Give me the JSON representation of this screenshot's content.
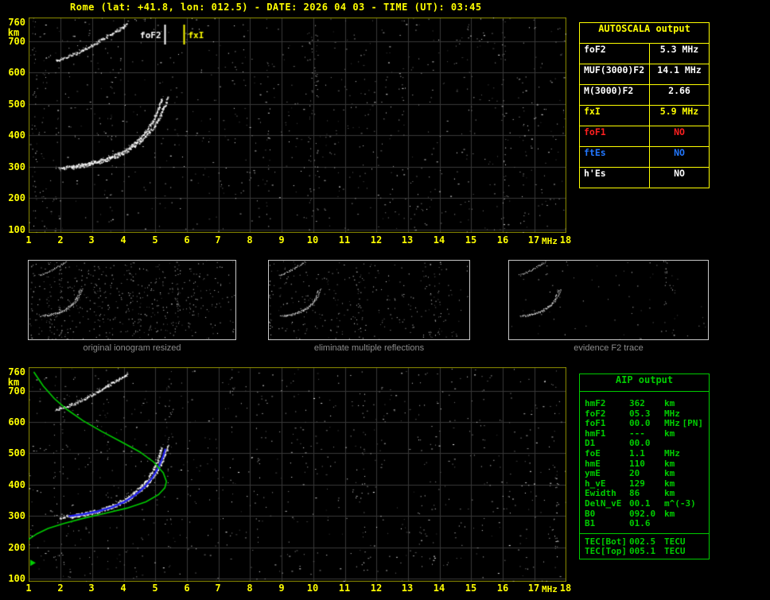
{
  "title": "Rome (lat: +41.8, lon: 012.5) - DATE: 2026 04 03 - TIME (UT): 03:45",
  "colors": {
    "background": "#000000",
    "axis_text": "#ffff00",
    "frame": "#8f8f00",
    "grid": "#383838",
    "echo_white": "#ffffff",
    "profile_green": "#00cc00",
    "restored_blue": "#2222ee",
    "table_yellow": "#ffff00",
    "aip_green": "#00cc00",
    "no_red": "#ff2020",
    "es_blue": "#2277ff",
    "caption_gray": "#8c8c8c"
  },
  "autoscala_table": {
    "title": "AUTOSCALA output",
    "rows": [
      {
        "param": "foF2",
        "value": "5.3 MHz",
        "color": "#ffffff"
      },
      {
        "param": "MUF(3000)F2",
        "value": "14.1 MHz",
        "color": "#ffffff"
      },
      {
        "param": "M(3000)F2",
        "value": "2.66",
        "color": "#ffffff"
      },
      {
        "param": "fxI",
        "value": "5.9 MHz",
        "color": "#ffff00"
      },
      {
        "param": "foF1",
        "value": "NO",
        "color": "#ff2020"
      },
      {
        "param": "ftEs",
        "value": "NO",
        "color": "#2277ff"
      },
      {
        "param": "h'Es",
        "value": "NO",
        "color": "#ffffff"
      }
    ]
  },
  "thumbnails": [
    {
      "caption": "original ionogram resized",
      "noise": 430,
      "columns": 12,
      "seed": 21
    },
    {
      "caption": "eliminate multiple reflections",
      "noise": 250,
      "columns": 9,
      "seed": 22
    },
    {
      "caption": "evidence F2 trace",
      "noise": 70,
      "columns": 2,
      "seed": 23
    }
  ],
  "aip_table": {
    "title": "AIP output",
    "rows": [
      {
        "param": "hmF2",
        "value": "362",
        "unit": "km",
        "note": ""
      },
      {
        "param": "foF2",
        "value": "05.3",
        "unit": "MHz",
        "note": ""
      },
      {
        "param": "foF1",
        "value": "00.0",
        "unit": "MHz",
        "note": "[PN]"
      },
      {
        "param": "hmF1",
        "value": "---",
        "unit": "km",
        "note": ""
      },
      {
        "param": "D1",
        "value": "00.0",
        "unit": "",
        "note": ""
      },
      {
        "param": "foE",
        "value": "1.1",
        "unit": "MHz",
        "note": ""
      },
      {
        "param": "hmE",
        "value": "110",
        "unit": "km",
        "note": ""
      },
      {
        "param": "ymE",
        "value": "20",
        "unit": "km",
        "note": ""
      },
      {
        "param": "h_vE",
        "value": "129",
        "unit": "km",
        "note": ""
      },
      {
        "param": "Ewidth",
        "value": "86",
        "unit": "km",
        "note": ""
      },
      {
        "param": "DelN_vE",
        "value": "00.1",
        "unit": "m^(-3)",
        "note": ""
      },
      {
        "param": "B0",
        "value": "092.0",
        "unit": "km",
        "note": ""
      },
      {
        "param": "B1",
        "value": "01.6",
        "unit": "",
        "note": ""
      }
    ],
    "tec_rows": [
      {
        "param": "TEC[Bot]",
        "value": "002.5",
        "unit": "TECU"
      },
      {
        "param": "TEC[Top]",
        "value": "005.1",
        "unit": "TECU"
      }
    ]
  },
  "chart_data": [
    {
      "name": "top_ionogram",
      "type": "scatter",
      "xlabel": "MHz",
      "ylabel": "km",
      "xlim": [
        1,
        18
      ],
      "ylim": [
        100,
        760
      ],
      "xticks": [
        1,
        2,
        3,
        4,
        5,
        6,
        7,
        8,
        9,
        10,
        11,
        12,
        13,
        14,
        15,
        16,
        17,
        18
      ],
      "yticks": [
        760,
        700,
        600,
        500,
        400,
        300,
        200,
        100
      ],
      "grid": true,
      "markers": [
        {
          "label": "foF2",
          "x": 5.3,
          "color": "#ffffff",
          "label_side": "left"
        },
        {
          "label": "fxI",
          "x": 5.9,
          "color": "#ffff00",
          "label_side": "right"
        }
      ],
      "series": [
        {
          "name": "F2 trace ordinary ray",
          "color": "#ffffff",
          "render": "scatter",
          "points": [
            [
              1.95,
              296
            ],
            [
              2.2,
              300
            ],
            [
              2.5,
              305
            ],
            [
              2.8,
              311
            ],
            [
              3.1,
              318
            ],
            [
              3.4,
              327
            ],
            [
              3.7,
              339
            ],
            [
              4.0,
              354
            ],
            [
              4.3,
              374
            ],
            [
              4.55,
              396
            ],
            [
              4.75,
              420
            ],
            [
              4.9,
              446
            ],
            [
              5.05,
              478
            ],
            [
              5.15,
              505
            ],
            [
              5.2,
              522
            ]
          ]
        },
        {
          "name": "F2 trace extraordinary ray",
          "color": "#ffffff",
          "render": "scatter",
          "points": [
            [
              2.35,
              298
            ],
            [
              2.7,
              304
            ],
            [
              3.05,
              312
            ],
            [
              3.4,
              322
            ],
            [
              3.75,
              335
            ],
            [
              4.1,
              352
            ],
            [
              4.4,
              374
            ],
            [
              4.7,
              400
            ],
            [
              4.95,
              430
            ],
            [
              5.15,
              465
            ],
            [
              5.3,
              500
            ],
            [
              5.4,
              528
            ]
          ]
        },
        {
          "name": "second hop reflection",
          "color": "#ffffff",
          "render": "scatter",
          "points": [
            [
              1.85,
              640
            ],
            [
              2.15,
              650
            ],
            [
              2.45,
              662
            ],
            [
              2.75,
              676
            ],
            [
              3.05,
              692
            ],
            [
              3.35,
              710
            ],
            [
              3.65,
              728
            ],
            [
              3.95,
              745
            ],
            [
              4.12,
              757
            ]
          ]
        }
      ],
      "noise": {
        "count": 850,
        "columns": 14,
        "seed": 7
      }
    },
    {
      "name": "bottom_ionogram",
      "type": "scatter",
      "xlabel": "MHz",
      "ylabel": "km",
      "xlim": [
        1,
        18
      ],
      "ylim": [
        100,
        760
      ],
      "xticks": [
        1,
        2,
        3,
        4,
        5,
        6,
        7,
        8,
        9,
        10,
        11,
        12,
        13,
        14,
        15,
        16,
        17,
        18
      ],
      "yticks": [
        760,
        700,
        600,
        500,
        400,
        300,
        200,
        100
      ],
      "grid": true,
      "series": [
        {
          "name": "F2 trace ordinary ray",
          "color": "#ffffff",
          "render": "scatter",
          "points": [
            [
              1.95,
              296
            ],
            [
              2.2,
              300
            ],
            [
              2.5,
              305
            ],
            [
              2.8,
              311
            ],
            [
              3.1,
              318
            ],
            [
              3.4,
              327
            ],
            [
              3.7,
              339
            ],
            [
              4.0,
              354
            ],
            [
              4.3,
              374
            ],
            [
              4.55,
              396
            ],
            [
              4.75,
              420
            ],
            [
              4.9,
              446
            ],
            [
              5.05,
              478
            ],
            [
              5.15,
              505
            ],
            [
              5.2,
              522
            ]
          ]
        },
        {
          "name": "F2 trace extraordinary ray",
          "color": "#ffffff",
          "render": "scatter",
          "points": [
            [
              2.35,
              298
            ],
            [
              2.7,
              304
            ],
            [
              3.05,
              312
            ],
            [
              3.4,
              322
            ],
            [
              3.75,
              335
            ],
            [
              4.1,
              352
            ],
            [
              4.4,
              374
            ],
            [
              4.7,
              400
            ],
            [
              4.95,
              430
            ],
            [
              5.15,
              465
            ],
            [
              5.3,
              500
            ],
            [
              5.4,
              528
            ]
          ]
        },
        {
          "name": "second hop reflection",
          "color": "#ffffff",
          "render": "scatter",
          "points": [
            [
              1.85,
              640
            ],
            [
              2.15,
              650
            ],
            [
              2.45,
              662
            ],
            [
              2.75,
              676
            ],
            [
              3.05,
              692
            ],
            [
              3.35,
              710
            ],
            [
              3.65,
              728
            ],
            [
              3.95,
              745
            ],
            [
              4.12,
              757
            ]
          ]
        },
        {
          "name": "restored F2 trace",
          "color": "#2222ee",
          "render": "line",
          "width": 2.4,
          "points": [
            [
              2.25,
              299
            ],
            [
              2.7,
              305
            ],
            [
              3.15,
              314
            ],
            [
              3.6,
              327
            ],
            [
              4.0,
              344
            ],
            [
              4.35,
              366
            ],
            [
              4.65,
              392
            ],
            [
              4.9,
              422
            ],
            [
              5.1,
              456
            ],
            [
              5.25,
              492
            ],
            [
              5.32,
              515
            ]
          ]
        },
        {
          "name": "electron density profile",
          "color": "#00cc00",
          "render": "line",
          "width": 1.6,
          "points": [
            [
              1.15,
              760
            ],
            [
              1.45,
              715
            ],
            [
              1.8,
              675
            ],
            [
              2.2,
              640
            ],
            [
              2.7,
              605
            ],
            [
              3.3,
              570
            ],
            [
              3.9,
              538
            ],
            [
              4.5,
              505
            ],
            [
              4.95,
              472
            ],
            [
              5.25,
              438
            ],
            [
              5.35,
              410
            ],
            [
              5.3,
              390
            ],
            [
              5.1,
              368
            ],
            [
              4.7,
              345
            ],
            [
              4.1,
              325
            ],
            [
              3.4,
              308
            ],
            [
              2.7,
              292
            ],
            [
              2.1,
              276
            ],
            [
              1.6,
              260
            ],
            [
              1.25,
              243
            ],
            [
              1.0,
              226
            ],
            [
              0.88,
              208
            ],
            [
              0.82,
              192
            ]
          ]
        }
      ],
      "annotations": [
        {
          "type": "triangle",
          "km": 150,
          "color": "#00cc00"
        }
      ],
      "noise": {
        "count": 750,
        "columns": 12,
        "seed": 13
      }
    }
  ]
}
